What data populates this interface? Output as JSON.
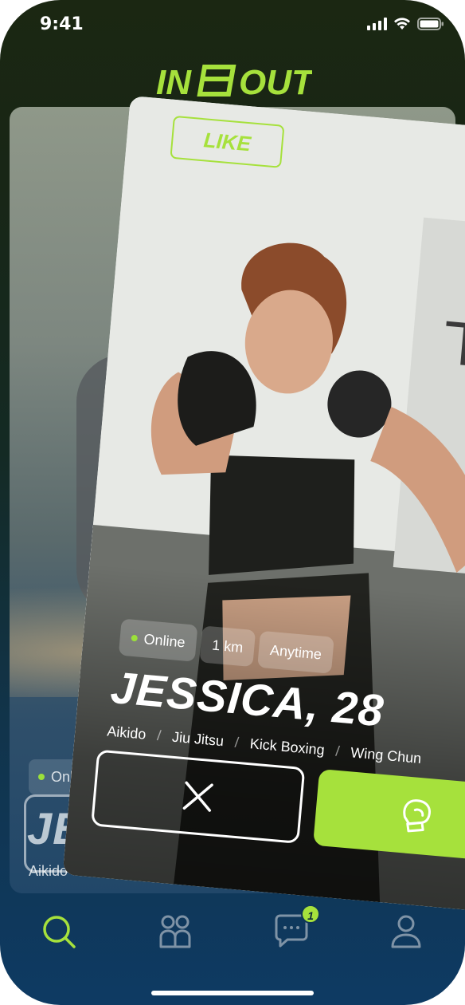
{
  "status_bar": {
    "time": "9:41"
  },
  "app": {
    "logo_text": "IN OUT",
    "accent_color": "#a6e13c"
  },
  "back_card": {
    "online_label": "Online",
    "name_partial": "JES",
    "tag_first": "Aikido"
  },
  "front_card": {
    "stamp_label": "LIKE",
    "chips": [
      {
        "label": "Online"
      },
      {
        "label": "1 km"
      },
      {
        "label": "Anytime"
      }
    ],
    "name": "JESSICA, 28",
    "tags": [
      "Aikido",
      "Jiu Jitsu",
      "Kick Boxing",
      "Wing Chun"
    ],
    "separator": "/",
    "actions": {
      "dislike_icon": "close-icon",
      "like_icon": "boxing-glove-icon"
    }
  },
  "nav": {
    "items": [
      {
        "icon": "search-icon",
        "active": true
      },
      {
        "icon": "people-icon",
        "active": false
      },
      {
        "icon": "chat-icon",
        "active": false,
        "badge": "1"
      },
      {
        "icon": "profile-icon",
        "active": false
      }
    ]
  }
}
